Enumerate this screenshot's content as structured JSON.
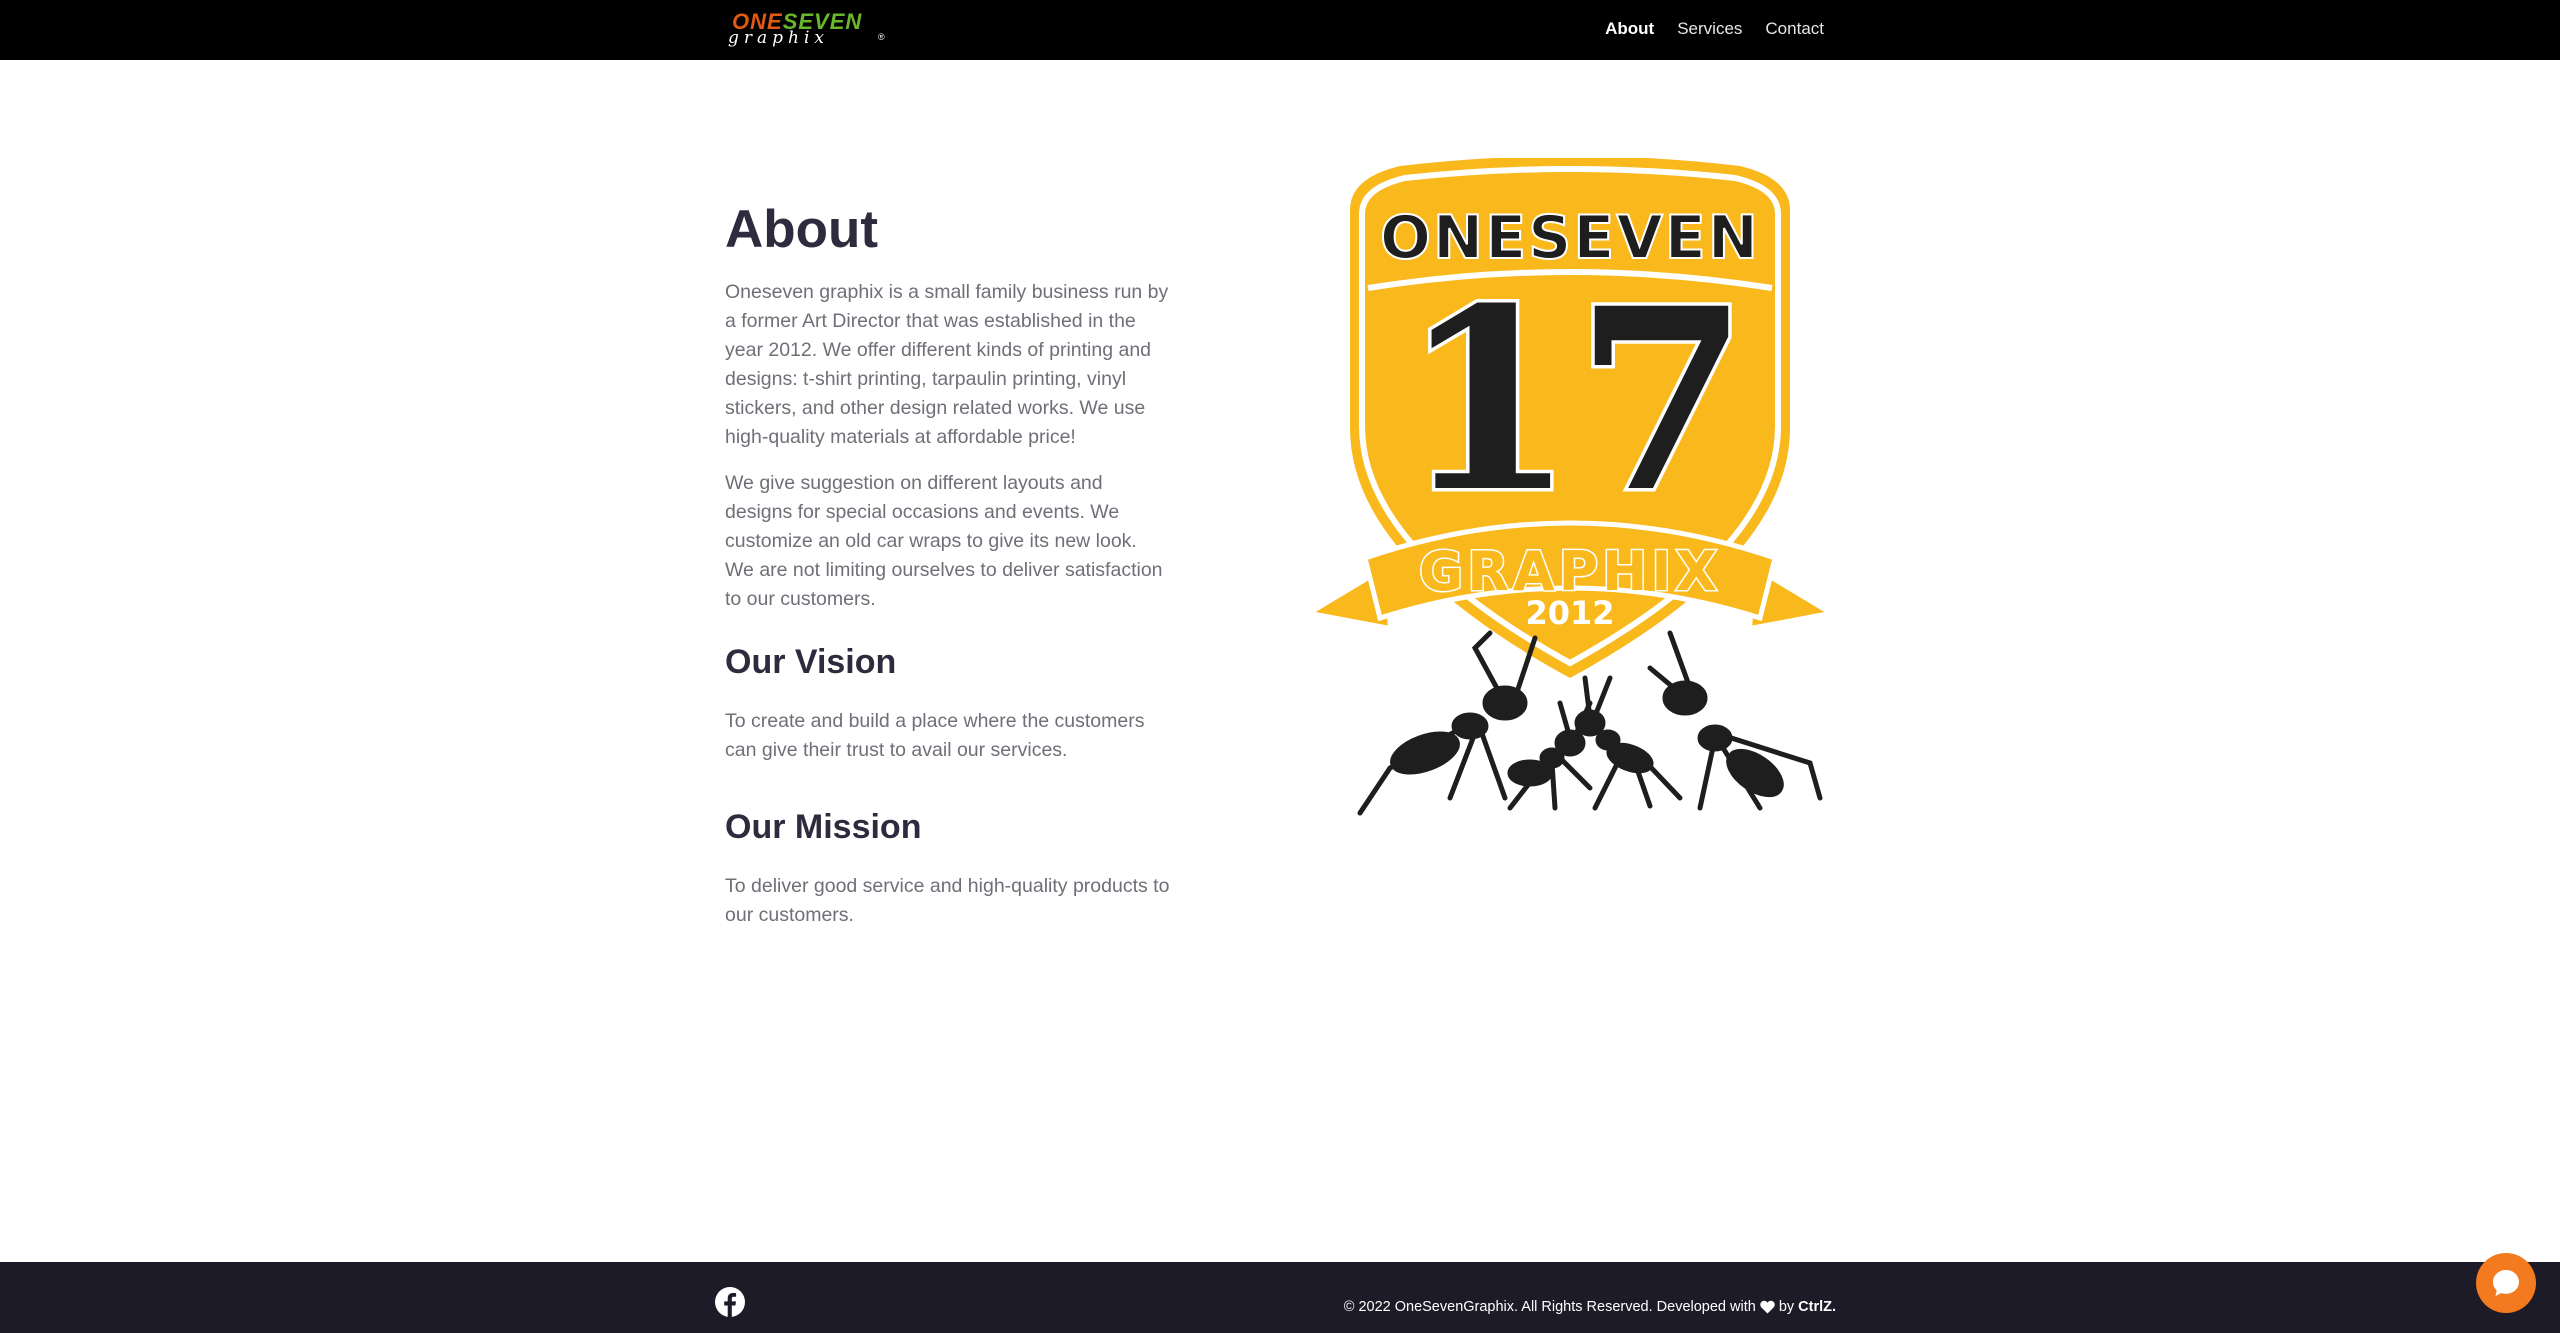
{
  "navbar": {
    "logo": {
      "top": "ONESEVEN",
      "top_part1": "ONE",
      "top_part2": "SEVEN",
      "bottom": "graphix",
      "mark": "®"
    },
    "links": [
      {
        "label": "About",
        "active": true
      },
      {
        "label": "Services",
        "active": false
      },
      {
        "label": "Contact",
        "active": false
      }
    ]
  },
  "main": {
    "title": "About",
    "paragraph1": "Oneseven graphix is a small family business run by a former Art Director that was established in the year 2012. We offer different kinds of printing and designs: t-shirt printing, tarpaulin printing, vinyl stickers, and other design related works. We use high-quality materials at affordable price!",
    "paragraph2": "We give suggestion on different layouts and designs for special occasions and events. We customize an old car wraps to give its new look. We are not limiting ourselves to deliver satisfaction to our customers.",
    "vision_heading": "Our Vision",
    "vision_text": "To create and build a place where the customers can give their trust to avail our services.",
    "mission_heading": "Our Mission",
    "mission_text": "To deliver good service and high-quality products to our customers."
  },
  "emblem": {
    "top_text": "ONESEVEN",
    "number": "17",
    "banner_text": "GRAPHIX",
    "year": "2012",
    "colors": {
      "gold": "#f9b91c",
      "dark": "#1e1e1e",
      "white": "#ffffff"
    }
  },
  "footer": {
    "social_icon": "facebook-icon",
    "copyright_prefix": "© 2022 OneSevenGraphix. All Rights Reserved. Developed with",
    "heart_icon": "heart-icon",
    "by": "by",
    "developer": "CtrlZ."
  },
  "chat_widget": {
    "icon": "chat-bubble-icon",
    "color": "#f47a1f"
  }
}
